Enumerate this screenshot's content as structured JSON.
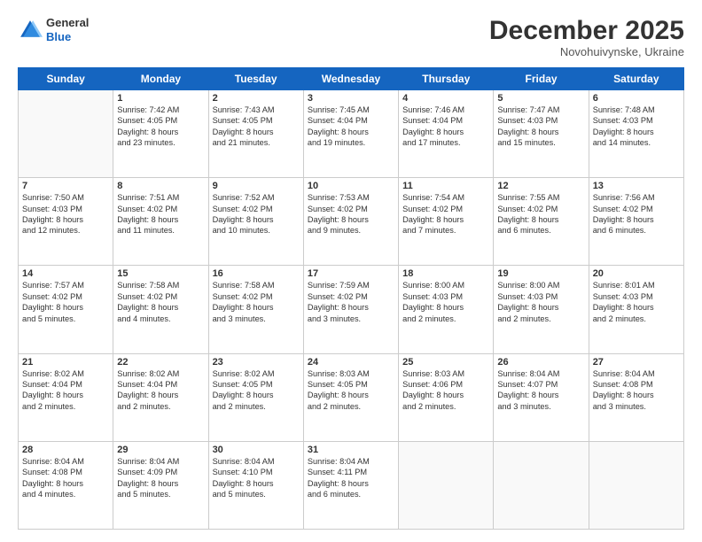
{
  "header": {
    "logo_line1": "General",
    "logo_line2": "Blue",
    "month": "December 2025",
    "location": "Novohuivynske, Ukraine"
  },
  "weekdays": [
    "Sunday",
    "Monday",
    "Tuesday",
    "Wednesday",
    "Thursday",
    "Friday",
    "Saturday"
  ],
  "weeks": [
    [
      {
        "day": "",
        "text": ""
      },
      {
        "day": "1",
        "text": "Sunrise: 7:42 AM\nSunset: 4:05 PM\nDaylight: 8 hours\nand 23 minutes."
      },
      {
        "day": "2",
        "text": "Sunrise: 7:43 AM\nSunset: 4:05 PM\nDaylight: 8 hours\nand 21 minutes."
      },
      {
        "day": "3",
        "text": "Sunrise: 7:45 AM\nSunset: 4:04 PM\nDaylight: 8 hours\nand 19 minutes."
      },
      {
        "day": "4",
        "text": "Sunrise: 7:46 AM\nSunset: 4:04 PM\nDaylight: 8 hours\nand 17 minutes."
      },
      {
        "day": "5",
        "text": "Sunrise: 7:47 AM\nSunset: 4:03 PM\nDaylight: 8 hours\nand 15 minutes."
      },
      {
        "day": "6",
        "text": "Sunrise: 7:48 AM\nSunset: 4:03 PM\nDaylight: 8 hours\nand 14 minutes."
      }
    ],
    [
      {
        "day": "7",
        "text": "Sunrise: 7:50 AM\nSunset: 4:03 PM\nDaylight: 8 hours\nand 12 minutes."
      },
      {
        "day": "8",
        "text": "Sunrise: 7:51 AM\nSunset: 4:02 PM\nDaylight: 8 hours\nand 11 minutes."
      },
      {
        "day": "9",
        "text": "Sunrise: 7:52 AM\nSunset: 4:02 PM\nDaylight: 8 hours\nand 10 minutes."
      },
      {
        "day": "10",
        "text": "Sunrise: 7:53 AM\nSunset: 4:02 PM\nDaylight: 8 hours\nand 9 minutes."
      },
      {
        "day": "11",
        "text": "Sunrise: 7:54 AM\nSunset: 4:02 PM\nDaylight: 8 hours\nand 7 minutes."
      },
      {
        "day": "12",
        "text": "Sunrise: 7:55 AM\nSunset: 4:02 PM\nDaylight: 8 hours\nand 6 minutes."
      },
      {
        "day": "13",
        "text": "Sunrise: 7:56 AM\nSunset: 4:02 PM\nDaylight: 8 hours\nand 6 minutes."
      }
    ],
    [
      {
        "day": "14",
        "text": "Sunrise: 7:57 AM\nSunset: 4:02 PM\nDaylight: 8 hours\nand 5 minutes."
      },
      {
        "day": "15",
        "text": "Sunrise: 7:58 AM\nSunset: 4:02 PM\nDaylight: 8 hours\nand 4 minutes."
      },
      {
        "day": "16",
        "text": "Sunrise: 7:58 AM\nSunset: 4:02 PM\nDaylight: 8 hours\nand 3 minutes."
      },
      {
        "day": "17",
        "text": "Sunrise: 7:59 AM\nSunset: 4:02 PM\nDaylight: 8 hours\nand 3 minutes."
      },
      {
        "day": "18",
        "text": "Sunrise: 8:00 AM\nSunset: 4:03 PM\nDaylight: 8 hours\nand 2 minutes."
      },
      {
        "day": "19",
        "text": "Sunrise: 8:00 AM\nSunset: 4:03 PM\nDaylight: 8 hours\nand 2 minutes."
      },
      {
        "day": "20",
        "text": "Sunrise: 8:01 AM\nSunset: 4:03 PM\nDaylight: 8 hours\nand 2 minutes."
      }
    ],
    [
      {
        "day": "21",
        "text": "Sunrise: 8:02 AM\nSunset: 4:04 PM\nDaylight: 8 hours\nand 2 minutes."
      },
      {
        "day": "22",
        "text": "Sunrise: 8:02 AM\nSunset: 4:04 PM\nDaylight: 8 hours\nand 2 minutes."
      },
      {
        "day": "23",
        "text": "Sunrise: 8:02 AM\nSunset: 4:05 PM\nDaylight: 8 hours\nand 2 minutes."
      },
      {
        "day": "24",
        "text": "Sunrise: 8:03 AM\nSunset: 4:05 PM\nDaylight: 8 hours\nand 2 minutes."
      },
      {
        "day": "25",
        "text": "Sunrise: 8:03 AM\nSunset: 4:06 PM\nDaylight: 8 hours\nand 2 minutes."
      },
      {
        "day": "26",
        "text": "Sunrise: 8:04 AM\nSunset: 4:07 PM\nDaylight: 8 hours\nand 3 minutes."
      },
      {
        "day": "27",
        "text": "Sunrise: 8:04 AM\nSunset: 4:08 PM\nDaylight: 8 hours\nand 3 minutes."
      }
    ],
    [
      {
        "day": "28",
        "text": "Sunrise: 8:04 AM\nSunset: 4:08 PM\nDaylight: 8 hours\nand 4 minutes."
      },
      {
        "day": "29",
        "text": "Sunrise: 8:04 AM\nSunset: 4:09 PM\nDaylight: 8 hours\nand 5 minutes."
      },
      {
        "day": "30",
        "text": "Sunrise: 8:04 AM\nSunset: 4:10 PM\nDaylight: 8 hours\nand 5 minutes."
      },
      {
        "day": "31",
        "text": "Sunrise: 8:04 AM\nSunset: 4:11 PM\nDaylight: 8 hours\nand 6 minutes."
      },
      {
        "day": "",
        "text": ""
      },
      {
        "day": "",
        "text": ""
      },
      {
        "day": "",
        "text": ""
      }
    ]
  ]
}
